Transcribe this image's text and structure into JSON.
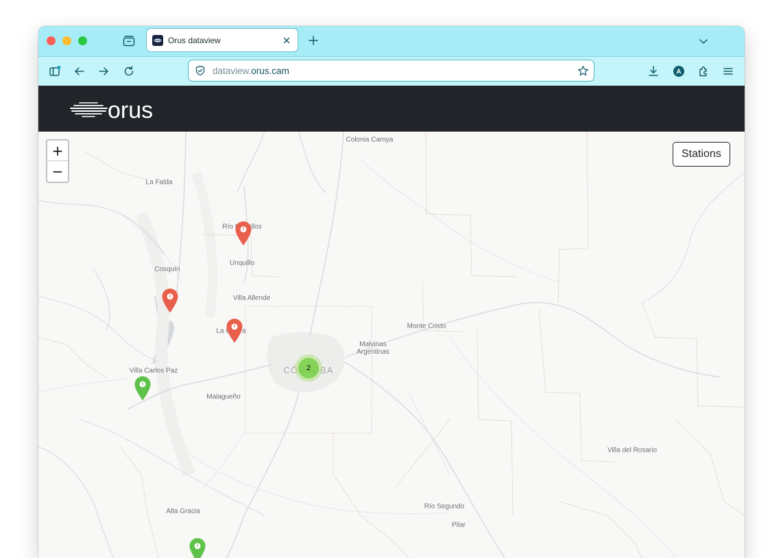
{
  "browser": {
    "tab": {
      "title": "Orus dataview",
      "close_icon": "close-icon"
    },
    "url": {
      "prefix": "dataview.",
      "domain": "orus.cam"
    },
    "colors": {
      "tabstrip": "#a6ecf6",
      "navbar": "#c4f5fb",
      "accent": "#0b6b7a"
    }
  },
  "header": {
    "logo_text": "orus",
    "colors": {
      "background": "#212529"
    }
  },
  "map": {
    "zoom_in_label": "+",
    "zoom_out_label": "−",
    "stations_label": "Stations",
    "places": {
      "colonia_caroya": "Colonia Caroya",
      "la_falda": "La Falda",
      "rio_ceballos": "Río Ceballos",
      "unquillo": "Unquillo",
      "cosquin": "Cosquín",
      "villa_allende": "Villa Allende",
      "la_calera": "La Calera",
      "monte_cristo": "Monte Cristo",
      "malvinas": "Malvinas\nArgentinas",
      "cordoba": "CÓRDOBA",
      "villa_carlos_paz": "Villa Carlos Paz",
      "malagueno": "Malagueño",
      "villa_del_rosario": "Villa del Rosario",
      "alta_gracia": "Alta Gracia",
      "rio_segundo": "Río Segundo",
      "pilar": "Pilar"
    },
    "cluster_count": "2",
    "marker_colors": {
      "red": "#e8604c",
      "green": "#5ec24a"
    },
    "markers": [
      {
        "name": "station-rio-ceballos",
        "status": "red"
      },
      {
        "name": "station-cosquin",
        "status": "red"
      },
      {
        "name": "station-la-calera",
        "status": "red"
      },
      {
        "name": "station-villa-carlos-paz",
        "status": "green"
      },
      {
        "name": "station-alta-gracia",
        "status": "green"
      }
    ]
  }
}
